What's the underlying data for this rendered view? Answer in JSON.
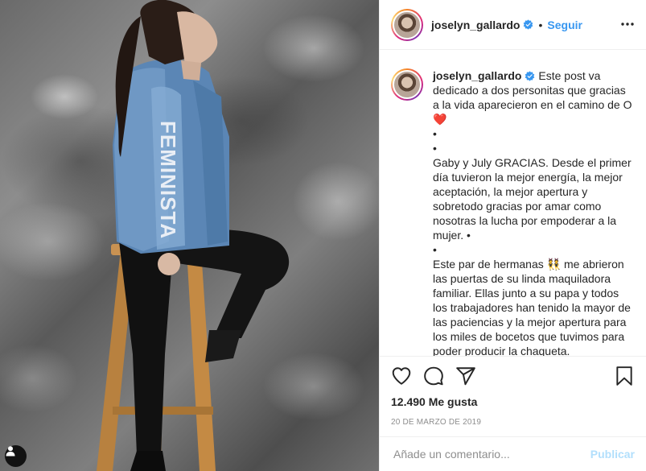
{
  "post": {
    "image_alt": "",
    "author": {
      "username": "joselyn_gallardo",
      "verified": true
    },
    "header": {
      "separator": "•",
      "follow_label": "Seguir",
      "more_icon": "more-horizontal-icon"
    },
    "caption": {
      "username": "joselyn_gallardo",
      "text": " Este post va dedicado a dos personitas que gracias a la vida aparecieron en el camino de O❤️\n•\n•\nGaby y July GRACIAS. Desde el primer día tuvieron la mejor energía, la mejor aceptación, la mejor apertura y sobretodo gracias por amar como nosotras la lucha por empoderar a la mujer. •\n•\nEste par de hermanas 👯 me abrieron las puertas de su linda maquiladora familiar. Ellas junto a su papa y todos los trabajadores han tenido la mayor de las paciencias y la mejor apertura para los miles de bocetos que tuvimos para poder producir la chaqueta."
    },
    "actions": {
      "like_icon": "heart-icon",
      "comment_icon": "comment-icon",
      "share_icon": "share-icon",
      "save_icon": "bookmark-icon"
    },
    "likes_label": "12.490 Me gusta",
    "date": "20 de marzo de 2019",
    "comment": {
      "placeholder": "Añade un comentario...",
      "publish_label": "Publicar"
    },
    "colors": {
      "accent": "#3897f0",
      "publish_disabled": "#b2dffc",
      "muted": "#8e8e8e"
    }
  }
}
